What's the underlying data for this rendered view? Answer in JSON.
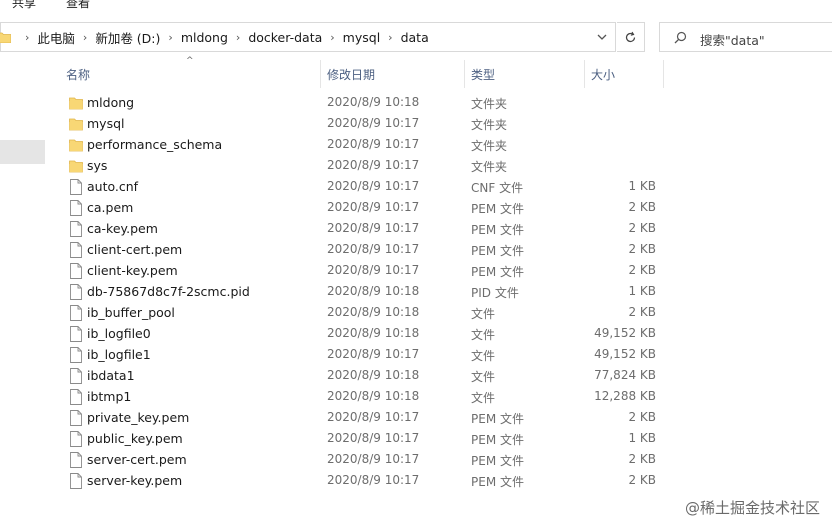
{
  "ribbon": {
    "share": "共享",
    "view": "查看"
  },
  "address": {
    "crumbs": [
      "此电脑",
      "新加卷 (D:)",
      "mldong",
      "docker-data",
      "mysql",
      "data"
    ],
    "separator": "›"
  },
  "search": {
    "placeholder": "搜索\"data\""
  },
  "columns": {
    "name": "名称",
    "modified": "修改日期",
    "type": "类型",
    "size": "大小"
  },
  "files": [
    {
      "name": "mldong",
      "modified": "2020/8/9 10:18",
      "type": "文件夹",
      "size": "",
      "kind": "folder"
    },
    {
      "name": "mysql",
      "modified": "2020/8/9 10:17",
      "type": "文件夹",
      "size": "",
      "kind": "folder"
    },
    {
      "name": "performance_schema",
      "modified": "2020/8/9 10:17",
      "type": "文件夹",
      "size": "",
      "kind": "folder"
    },
    {
      "name": "sys",
      "modified": "2020/8/9 10:17",
      "type": "文件夹",
      "size": "",
      "kind": "folder"
    },
    {
      "name": "auto.cnf",
      "modified": "2020/8/9 10:17",
      "type": "CNF 文件",
      "size": "1 KB",
      "kind": "file"
    },
    {
      "name": "ca.pem",
      "modified": "2020/8/9 10:17",
      "type": "PEM 文件",
      "size": "2 KB",
      "kind": "file"
    },
    {
      "name": "ca-key.pem",
      "modified": "2020/8/9 10:17",
      "type": "PEM 文件",
      "size": "2 KB",
      "kind": "file"
    },
    {
      "name": "client-cert.pem",
      "modified": "2020/8/9 10:17",
      "type": "PEM 文件",
      "size": "2 KB",
      "kind": "file"
    },
    {
      "name": "client-key.pem",
      "modified": "2020/8/9 10:17",
      "type": "PEM 文件",
      "size": "2 KB",
      "kind": "file"
    },
    {
      "name": "db-75867d8c7f-2scmc.pid",
      "modified": "2020/8/9 10:18",
      "type": "PID 文件",
      "size": "1 KB",
      "kind": "file"
    },
    {
      "name": "ib_buffer_pool",
      "modified": "2020/8/9 10:18",
      "type": "文件",
      "size": "2 KB",
      "kind": "file"
    },
    {
      "name": "ib_logfile0",
      "modified": "2020/8/9 10:18",
      "type": "文件",
      "size": "49,152 KB",
      "kind": "file"
    },
    {
      "name": "ib_logfile1",
      "modified": "2020/8/9 10:17",
      "type": "文件",
      "size": "49,152 KB",
      "kind": "file"
    },
    {
      "name": "ibdata1",
      "modified": "2020/8/9 10:18",
      "type": "文件",
      "size": "77,824 KB",
      "kind": "file"
    },
    {
      "name": "ibtmp1",
      "modified": "2020/8/9 10:18",
      "type": "文件",
      "size": "12,288 KB",
      "kind": "file"
    },
    {
      "name": "private_key.pem",
      "modified": "2020/8/9 10:17",
      "type": "PEM 文件",
      "size": "2 KB",
      "kind": "file"
    },
    {
      "name": "public_key.pem",
      "modified": "2020/8/9 10:17",
      "type": "PEM 文件",
      "size": "1 KB",
      "kind": "file"
    },
    {
      "name": "server-cert.pem",
      "modified": "2020/8/9 10:17",
      "type": "PEM 文件",
      "size": "2 KB",
      "kind": "file"
    },
    {
      "name": "server-key.pem",
      "modified": "2020/8/9 10:17",
      "type": "PEM 文件",
      "size": "2 KB",
      "kind": "file"
    }
  ],
  "watermark": "@稀土掘金技术社区",
  "colors": {
    "folder": "#f8d775",
    "folder_dark": "#e0b54a",
    "header_text": "#4d6082",
    "meta_text": "#6d6d6d"
  }
}
